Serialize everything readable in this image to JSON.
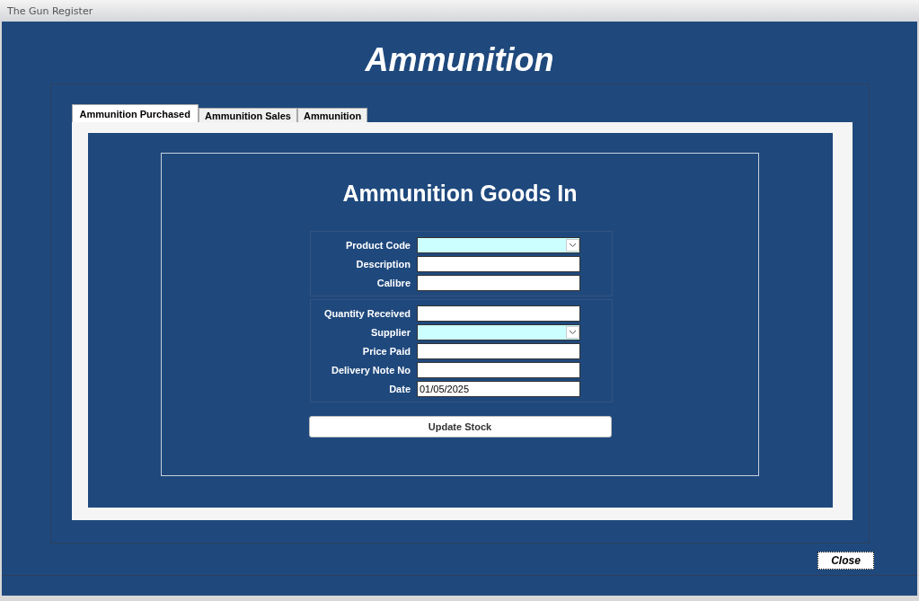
{
  "window": {
    "title": "The Gun Register"
  },
  "heading": "Ammunition",
  "tabs": [
    {
      "label": "Ammunition Purchased",
      "selected": true
    },
    {
      "label": "Ammunition Sales",
      "selected": false
    },
    {
      "label": "Ammunition",
      "selected": false
    }
  ],
  "form": {
    "title": "Ammunition Goods In",
    "groups": [
      {
        "fields": [
          {
            "label": "Product Code",
            "kind": "combo"
          },
          {
            "label": "Description",
            "kind": "text"
          },
          {
            "label": "Calibre",
            "kind": "text"
          }
        ]
      },
      {
        "fields": [
          {
            "label": "Quantity Received",
            "kind": "text"
          },
          {
            "label": "Supplier",
            "kind": "combo"
          },
          {
            "label": "Price Paid",
            "kind": "text"
          },
          {
            "label": "Delivery Note No",
            "kind": "text"
          },
          {
            "label": "Date",
            "kind": "text",
            "value": "01/05/2025"
          }
        ]
      }
    ],
    "button": "Update Stock"
  },
  "close_button": "Close"
}
